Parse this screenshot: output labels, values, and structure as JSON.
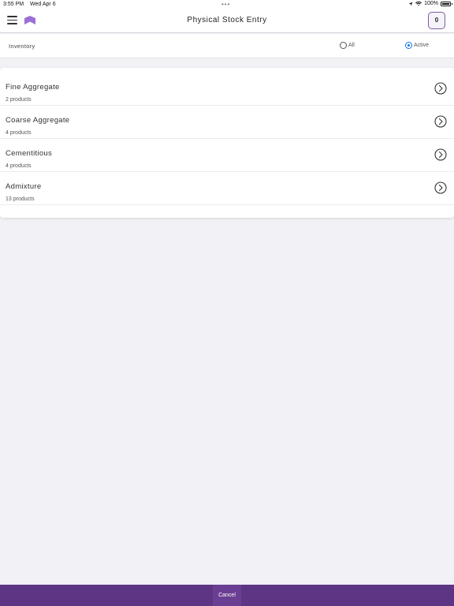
{
  "status_bar": {
    "time": "3:55 PM",
    "date": "Wed Apr 6",
    "dots": "•••",
    "battery": "100%"
  },
  "header": {
    "title": "Physical Stock Entry",
    "badge_count": "0",
    "menu_icon": "hamburger-menu-icon",
    "logo_icon": "brand-logo-icon"
  },
  "filter": {
    "label": "Inventory",
    "options": [
      {
        "label": "All",
        "selected": false
      },
      {
        "label": "Active",
        "selected": true
      }
    ]
  },
  "categories": [
    {
      "name": "Fine Aggregate",
      "count": "2 products"
    },
    {
      "name": "Coarse Aggregate",
      "count": "4 products"
    },
    {
      "name": "Cementitious",
      "count": "4 products"
    },
    {
      "name": "Admixture",
      "count": "13 products"
    }
  ],
  "footer": {
    "cancel_label": "Cancel"
  },
  "colors": {
    "accent": "#5e3585",
    "logo": "#9b6fd6",
    "radio_selected": "#1a73e8",
    "background": "#f2f1f6"
  }
}
